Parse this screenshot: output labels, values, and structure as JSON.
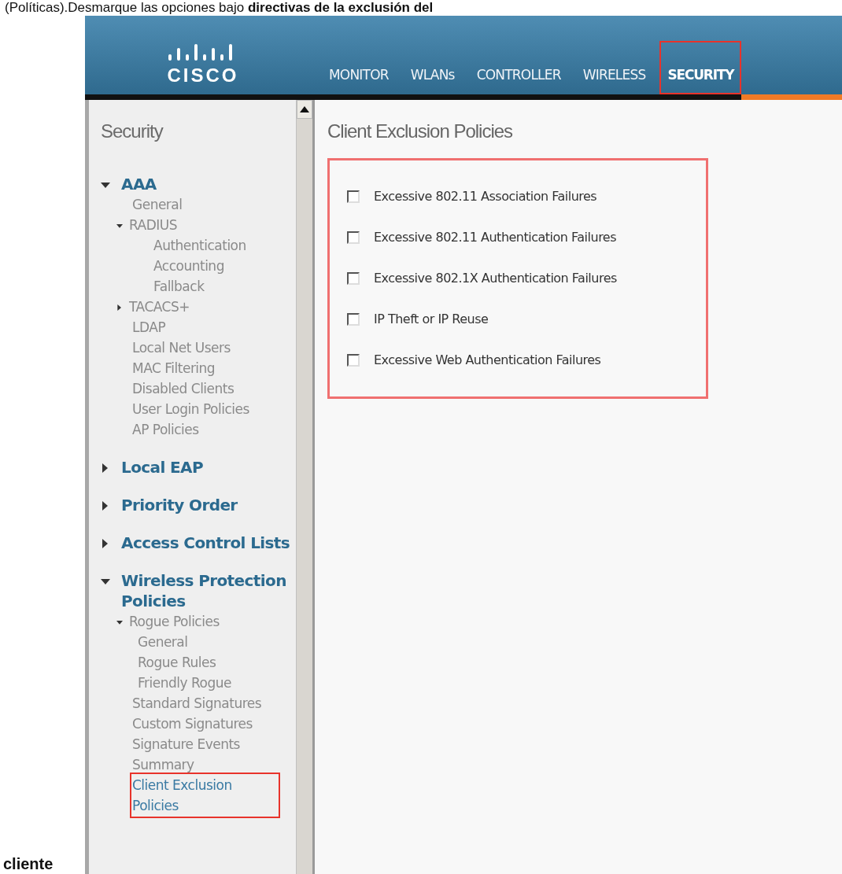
{
  "document": {
    "intro_text": "(Políticas).Desmarque las opciones bajo **directivas de la exclusión del**",
    "trailing_text": "cliente"
  },
  "header": {
    "logo_text": "CISCO",
    "nav": [
      {
        "label": "MONITOR",
        "selected": false,
        "highlighted": false
      },
      {
        "label": "WLANs",
        "selected": false,
        "highlighted": false
      },
      {
        "label": "CONTROLLER",
        "selected": false,
        "highlighted": false
      },
      {
        "label": "WIRELESS",
        "selected": false,
        "highlighted": false
      },
      {
        "label": "SECURITY",
        "selected": true,
        "highlighted": true
      }
    ]
  },
  "sidebar": {
    "title": "Security",
    "items": [
      {
        "label": "AAA",
        "kind": "group",
        "expanded": true,
        "children": [
          {
            "label": "General",
            "kind": "page",
            "selected": false
          },
          {
            "label": "RADIUS",
            "kind": "group",
            "expanded": true,
            "children": [
              {
                "label": "Authentication",
                "kind": "page",
                "selected": false
              },
              {
                "label": "Accounting",
                "kind": "page",
                "selected": false
              },
              {
                "label": "Fallback",
                "kind": "page",
                "selected": false
              }
            ]
          },
          {
            "label": "TACACS+",
            "kind": "group",
            "expanded": false
          },
          {
            "label": "LDAP",
            "kind": "page",
            "selected": false
          },
          {
            "label": "Local Net Users",
            "kind": "page",
            "selected": false
          },
          {
            "label": "MAC Filtering",
            "kind": "page",
            "selected": false
          },
          {
            "label": "Disabled Clients",
            "kind": "page",
            "selected": false
          },
          {
            "label": "User Login Policies",
            "kind": "page",
            "selected": false
          },
          {
            "label": "AP Policies",
            "kind": "page",
            "selected": false
          }
        ]
      },
      {
        "label": "Local EAP",
        "kind": "group",
        "expanded": false
      },
      {
        "label": "Priority Order",
        "kind": "group",
        "expanded": false
      },
      {
        "label": "Access Control Lists",
        "kind": "group",
        "expanded": false
      },
      {
        "label": "Wireless Protection Policies",
        "kind": "group",
        "expanded": true,
        "children": [
          {
            "label": "Rogue Policies",
            "kind": "group",
            "expanded": true,
            "children": [
              {
                "label": "General",
                "kind": "page",
                "selected": false
              },
              {
                "label": "Rogue Rules",
                "kind": "page",
                "selected": false
              },
              {
                "label": "Friendly Rogue",
                "kind": "page",
                "selected": false
              }
            ]
          },
          {
            "label": "Standard Signatures",
            "kind": "page",
            "selected": false
          },
          {
            "label": "Custom Signatures",
            "kind": "page",
            "selected": false
          },
          {
            "label": "Signature Events Summary",
            "kind": "page",
            "selected": false
          },
          {
            "label": "Client Exclusion Policies",
            "kind": "page",
            "selected": true,
            "highlighted": true
          }
        ]
      }
    ]
  },
  "content": {
    "title": "Client Exclusion Policies",
    "highlighted": true,
    "options": [
      {
        "label": "Excessive 802.11 Association Failures",
        "checked": false
      },
      {
        "label": "Excessive 802.11 Authentication Failures",
        "checked": false
      },
      {
        "label": "Excessive 802.1X Authentication Failures",
        "checked": false
      },
      {
        "label": "IP Theft or IP Reuse",
        "checked": false
      },
      {
        "label": "Excessive Web Authentication Failures",
        "checked": false
      }
    ]
  }
}
